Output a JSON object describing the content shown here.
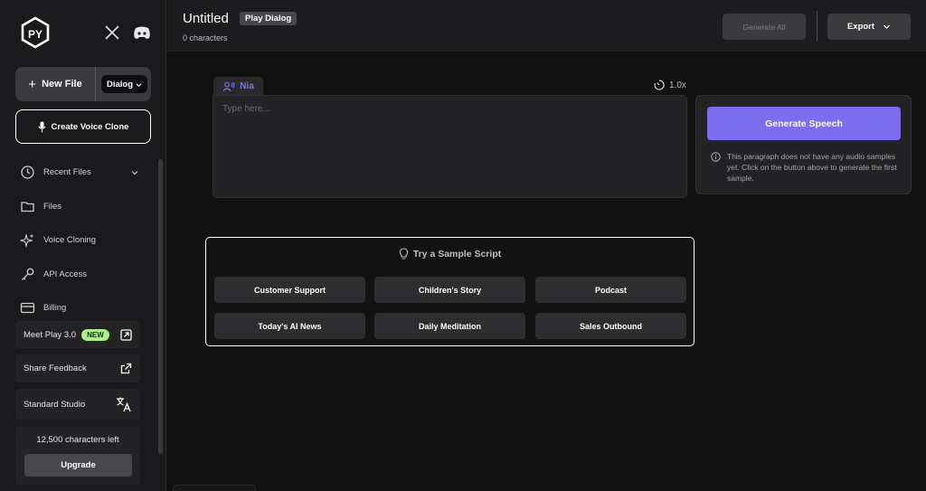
{
  "sidebar": {
    "new_file_label": "New File",
    "dialog_select": "Dialog",
    "create_voice_clone": "Create Voice Clone",
    "nav": [
      {
        "label": "Recent Files",
        "icon": "clock-icon"
      },
      {
        "label": "Files",
        "icon": "folder-icon"
      },
      {
        "label": "Voice Cloning",
        "icon": "sparkle-icon"
      },
      {
        "label": "API Access",
        "icon": "key-icon"
      },
      {
        "label": "Billing",
        "icon": "card-icon"
      }
    ],
    "meet_play": "Meet Play 3.0",
    "new_badge": "NEW",
    "share_feedback": "Share Feedback",
    "standard_studio": "Standard Studio",
    "characters_left": "12,500 characters left",
    "upgrade": "Upgrade"
  },
  "header": {
    "title": "Untitled",
    "mode": "Play Dialog",
    "char_count": "0 characters",
    "generate_all": "Generate All",
    "export": "Export"
  },
  "editor": {
    "speaker": "Nia",
    "speed": "1.0x",
    "placeholder": "Type here..."
  },
  "generate_panel": {
    "button": "Generate Speech",
    "info": "This paragraph does not have any audio samples yet. Click on the button above to generate the first sample."
  },
  "samples": {
    "title": "Try a Sample Script",
    "items": [
      "Customer Support",
      "Children's Story",
      "Podcast",
      "Today's AI News",
      "Daily Meditation",
      "Sales Outbound"
    ]
  },
  "colors": {
    "accent": "#7b6cf0",
    "speaker": "#6f7df0",
    "new_badge": "#a8f08c"
  }
}
